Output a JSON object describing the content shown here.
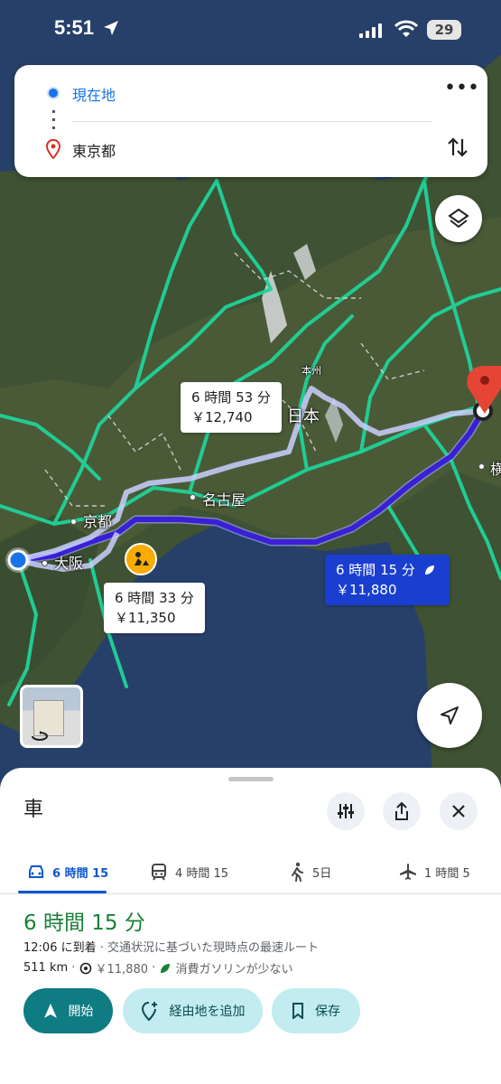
{
  "status_bar": {
    "time": "5:51",
    "battery": "29"
  },
  "search": {
    "origin": "現在地",
    "destination": "東京都"
  },
  "map": {
    "places": {
      "kyoto": "京都",
      "osaka": "大阪",
      "nagoya": "名古屋",
      "honshu": "本州",
      "japan": "日本",
      "yoko": "横"
    },
    "routes": [
      {
        "time": "6 時間 53 分",
        "fare": "￥12,740"
      },
      {
        "time": "6 時間 33 分",
        "fare": "￥11,350"
      },
      {
        "time": "6 時間 15 分",
        "fare": "￥11,880"
      }
    ]
  },
  "sheet": {
    "title": "車",
    "tabs": [
      {
        "label": "6 時間 15",
        "icon": "car-icon"
      },
      {
        "label": "4 時間 15",
        "icon": "train-icon"
      },
      {
        "label": "5日",
        "icon": "walk-icon"
      },
      {
        "label": "1 時間 5",
        "icon": "plane-icon"
      }
    ],
    "duration": "6 時間 15 分",
    "eta": "12:06 に到着",
    "eta_note": " · 交通状況に基づいた現時点の最速ルート",
    "distance": "511 km",
    "toll": "￥11,880",
    "eco_note": "消費ガソリンが少ない",
    "buttons": {
      "start": "開始",
      "add_stop": "経由地を追加",
      "save": "保存"
    }
  },
  "colors": {
    "accent": "#0f7b82",
    "route_best": "#3b1fd6",
    "duration_green": "#188038"
  }
}
